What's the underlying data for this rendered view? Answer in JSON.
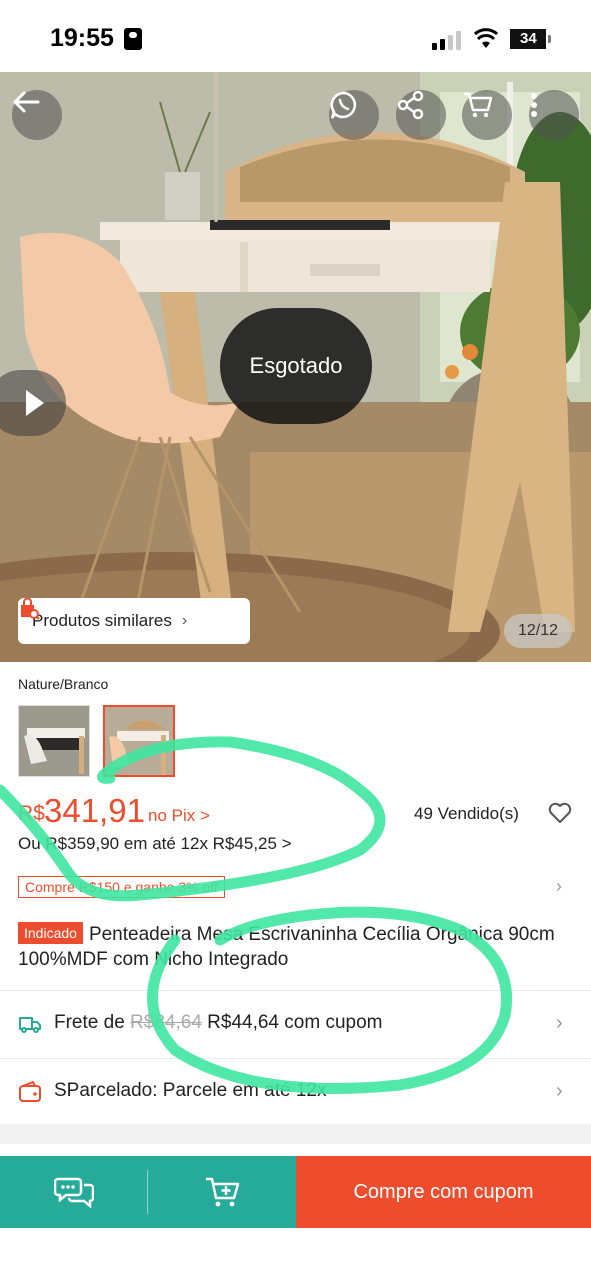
{
  "status_bar": {
    "time": "19:55",
    "battery": "34",
    "battery_level": 0.34
  },
  "hero": {
    "sold_out_label": "Esgotado",
    "similar_products_label": "Produtos similares",
    "image_counter": "12/12",
    "icons": [
      "back-arrow-icon",
      "whatsapp-icon",
      "share-icon",
      "cart-icon",
      "more-vertical-icon",
      "play-icon"
    ]
  },
  "variation": {
    "label": "Nature/Branco"
  },
  "price": {
    "currency": "R$",
    "value": "341,91",
    "pix_label": "no Pix >",
    "sold": "49 Vendido(s)",
    "installments": "Ou R$359,90 em até 12x R$45,25 >"
  },
  "promo": {
    "badge": "Compre R$150 e ganhe 3% off"
  },
  "product": {
    "tag": "Indicado",
    "title": "Penteadeira Mesa Escrivaninha Cecília Orgânica 90cm 100%MDF com Nicho Integrado"
  },
  "shipping": {
    "prefix": "Frete de ",
    "old_price": "R$84,64",
    "new_price": " R$44,64 com cupom"
  },
  "installment_plan": {
    "label": "SParcelado: Parcele em até 12x"
  },
  "bottom_bar": {
    "buy_label": "Compre com cupom"
  },
  "colors": {
    "brand_orange": "#ee4d2d",
    "teal": "#26aa99",
    "annotation_green": "#3ee6a0"
  }
}
